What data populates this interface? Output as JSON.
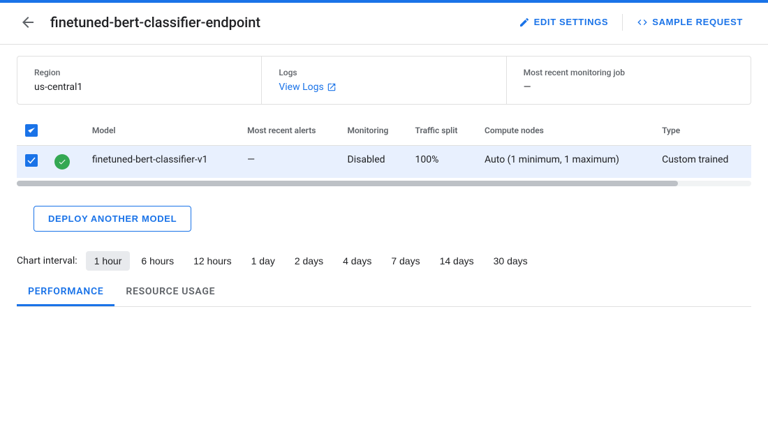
{
  "topBar": {
    "title": "finetuned-bert-classifier-endpoint",
    "editSettingsLabel": "EDIT SETTINGS",
    "sampleRequestLabel": "SAMPLE REQUEST"
  },
  "infoSection": {
    "region": {
      "label": "Region",
      "value": "us-central1"
    },
    "logs": {
      "label": "Logs",
      "linkText": "View Logs",
      "linkIcon": "external-link-icon"
    },
    "monitoring": {
      "label": "Most recent monitoring job",
      "value": "—"
    }
  },
  "table": {
    "columns": [
      "",
      "",
      "Model",
      "Most recent alerts",
      "Monitoring",
      "Traffic split",
      "Compute nodes",
      "Type"
    ],
    "rows": [
      {
        "checked": true,
        "status": "green",
        "model": "finetuned-bert-classifier-v1",
        "alerts": "—",
        "monitoring": "Disabled",
        "trafficSplit": "100%",
        "computeNodes": "Auto (1 minimum, 1 maximum)",
        "type": "Custom trained"
      }
    ]
  },
  "deployButton": "DEPLOY ANOTHER MODEL",
  "chartInterval": {
    "label": "Chart interval:",
    "options": [
      "1 hour",
      "6 hours",
      "12 hours",
      "1 day",
      "2 days",
      "4 days",
      "7 days",
      "14 days",
      "30 days"
    ],
    "activeIndex": 0
  },
  "tabs": [
    {
      "label": "PERFORMANCE",
      "active": true
    },
    {
      "label": "RESOURCE USAGE",
      "active": false
    }
  ]
}
